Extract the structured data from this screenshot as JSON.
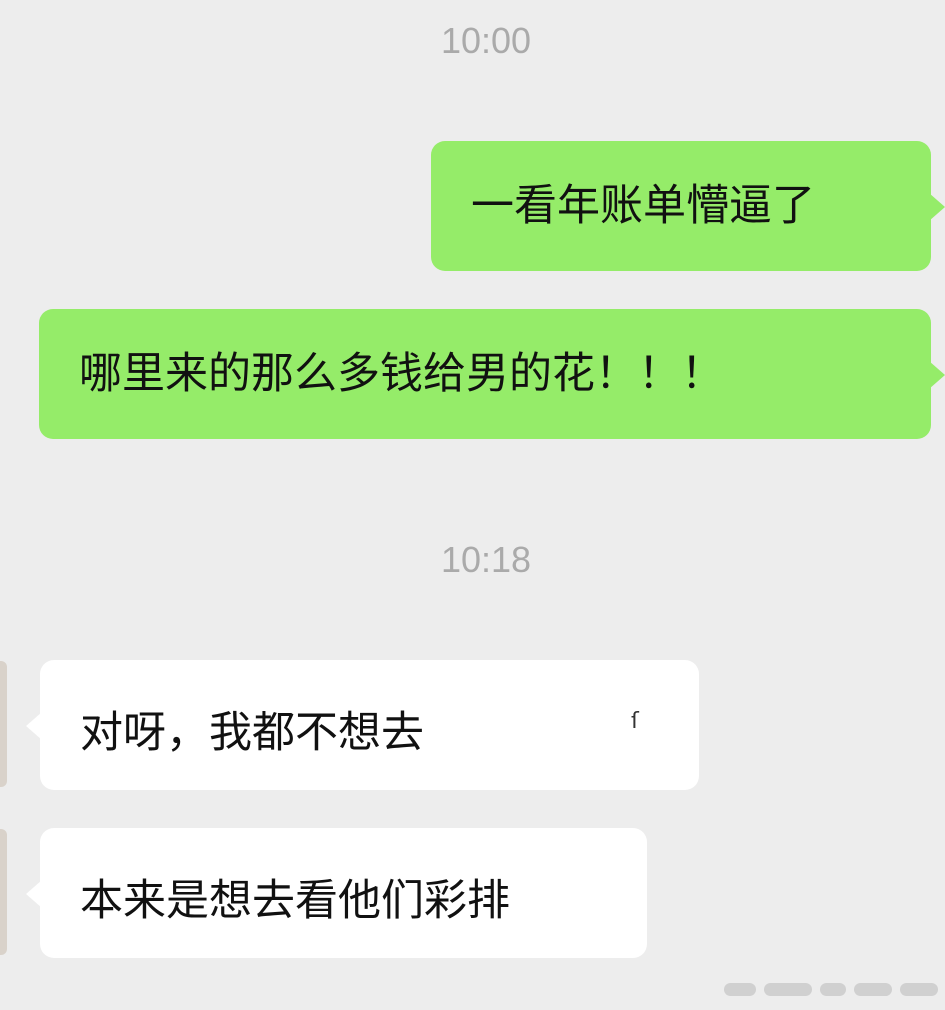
{
  "chat": {
    "timestamps": [
      "10:00",
      "10:18"
    ],
    "messages": [
      {
        "side": "outgoing",
        "text": "一看年账单懵逼了"
      },
      {
        "side": "outgoing",
        "text": "哪里来的那么多钱给男的花！！！"
      },
      {
        "side": "incoming",
        "text": "对呀，我都不想去"
      },
      {
        "side": "incoming",
        "text": "本来是想去看他们彩排"
      }
    ]
  },
  "colors": {
    "background": "#ededed",
    "outgoing_bubble": "#95ec69",
    "incoming_bubble": "#ffffff",
    "timestamp_text": "#aaaaaa"
  }
}
